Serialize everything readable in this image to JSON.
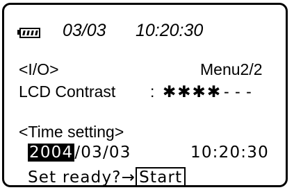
{
  "status": {
    "date": "03/03",
    "time": "10:20:30",
    "battery_icon": "battery-full-icon"
  },
  "io": {
    "header": "<I/O>",
    "menu_page": "Menu2/2"
  },
  "contrast": {
    "label": "LCD Contrast",
    "separator": ":",
    "level_text": "✱✱✱✱",
    "remaining_text": "- - -"
  },
  "time_setting": {
    "header": "<Time setting>",
    "year": "2004",
    "date_rest": "/03/03",
    "time": "10:20:30",
    "prompt": "Set ready?→",
    "start_label": "Start"
  }
}
